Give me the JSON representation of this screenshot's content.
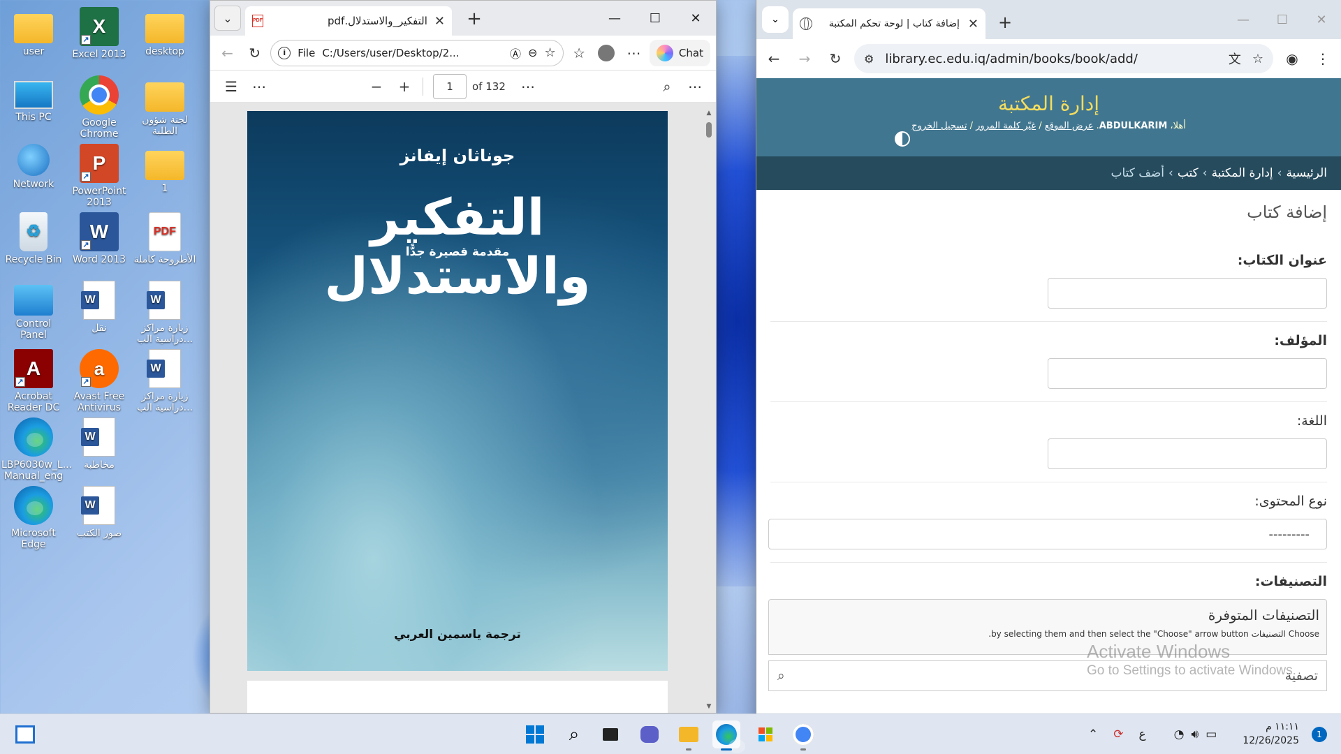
{
  "desktop": {
    "icons": [
      {
        "label": "user",
        "icon": "user-folder-icon"
      },
      {
        "label": "Excel 2013",
        "icon": "excel-icon"
      },
      {
        "label": "desktop",
        "icon": "folder-icon"
      },
      {
        "label": "This PC",
        "icon": "monitor-icon"
      },
      {
        "label": "Google Chrome",
        "icon": "chrome-icon"
      },
      {
        "label": "لجنة شؤون الطلبة",
        "icon": "folder-icon"
      },
      {
        "label": "Network",
        "icon": "network-icon"
      },
      {
        "label": "PowerPoint 2013",
        "icon": "powerpoint-icon"
      },
      {
        "label": "1",
        "icon": "folder-icon"
      },
      {
        "label": "Recycle Bin",
        "icon": "recycle-bin-icon"
      },
      {
        "label": "Word 2013",
        "icon": "word-icon"
      },
      {
        "label": "الأطروحة كاملة",
        "icon": "pdf-file-icon"
      },
      {
        "label": "Control Panel",
        "icon": "control-panel-icon"
      },
      {
        "label": "نقل",
        "icon": "word-doc-icon"
      },
      {
        "label": "زيارة مراكز دراسية الب...",
        "icon": "word-doc-icon"
      },
      {
        "label": "Acrobat Reader DC",
        "icon": "acrobat-icon"
      },
      {
        "label": "Avast Free Antivirus",
        "icon": "avast-icon"
      },
      {
        "label": "زيارة مراكز دراسية الب...",
        "icon": "word-doc-icon"
      },
      {
        "label": "LBP6030w_L... Manual_eng",
        "icon": "edge-icon"
      },
      {
        "label": "مخاطبة",
        "icon": "word-doc-icon"
      },
      {
        "label": "Microsoft Edge",
        "icon": "edge-icon"
      },
      {
        "label": "صور الكتب",
        "icon": "word-doc-icon"
      }
    ]
  },
  "pdf_window": {
    "tab_title": "التفكير_والاستدلال.pdf",
    "address_scheme": "File",
    "address": "C:/Users/user/Desktop/2...",
    "chat_label": "Chat",
    "page_current": "1",
    "page_total": "of 132",
    "cover": {
      "author": "جوناثان إيفانز",
      "title": "التفكير والاستدلال",
      "subtitle": "مقدمة قصيرة جدًّا",
      "translator": "ترجمة ياسمين العربي"
    }
  },
  "chrome_window": {
    "tab_title": "إضافة كتاب | لوحة تحكم المكتبة",
    "url": "library.ec.edu.iq/admin/books/book/add/"
  },
  "admin": {
    "branding": "إدارة المكتبة",
    "welcome": "أهلا،",
    "username": "ABDULKARIM",
    "view_site": "عرض الموقع",
    "change_password": "غيّر كلمة المرور",
    "logout": "تسجيل الخروج",
    "breadcrumbs": [
      "الرئيسية",
      "إدارة المكتبة",
      "كتب",
      "أضف كتاب"
    ],
    "page_title": "إضافة كتاب",
    "fields": {
      "title_label": "عنوان الكتاب:",
      "author_label": "المؤلف:",
      "language_label": "اللغة:",
      "content_type_label": "نوع المحتوى:",
      "content_type_value": "---------",
      "categories_label": "التصنيفات:",
      "available_categories": "التصنيفات المتوفرة",
      "selector_help": "Choose التصنيفات by selecting them and then select the \"Choose\" arrow button.",
      "filter_placeholder": "تصفية"
    },
    "watermark_line1": "Activate Windows",
    "watermark_line2": "Go to Settings to activate Windows."
  },
  "taskbar": {
    "lang": "ع",
    "time": "١١:١١ م",
    "date": "12/26/2025",
    "notifications": "1"
  }
}
